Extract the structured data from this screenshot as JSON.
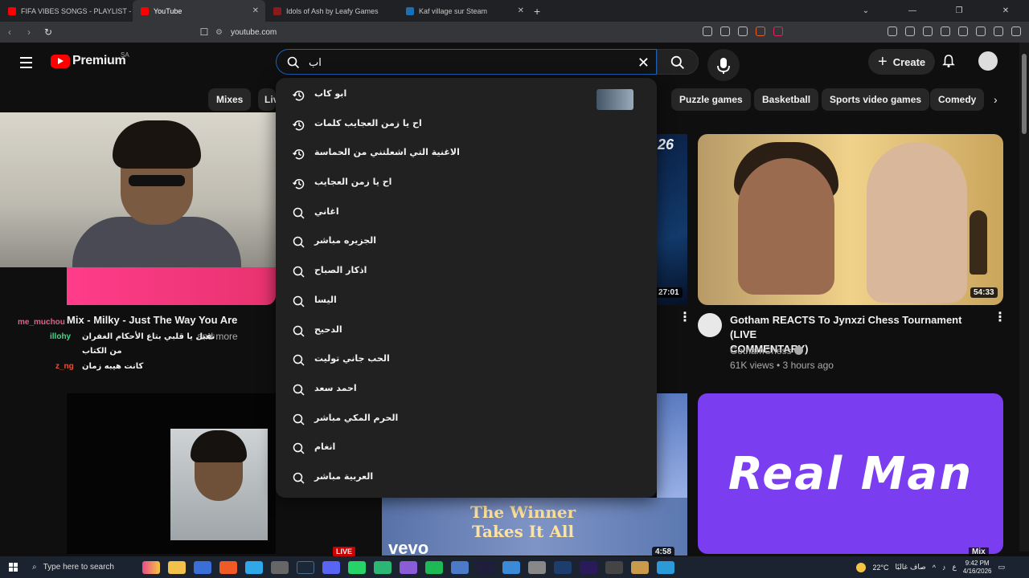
{
  "browser": {
    "tabs": [
      {
        "title": "FIFA VIBES SONGS - PLAYLIST - Y",
        "active": false,
        "favicon_color": "#ff0000"
      },
      {
        "title": "YouTube",
        "active": true,
        "favicon_color": "#ff0000"
      },
      {
        "title": "Idols of Ash by Leafy Games",
        "active": false,
        "favicon_color": "#8b1a1a"
      },
      {
        "title": "Kaf village sur Steam",
        "active": false,
        "favicon_color": "#1b6fb5"
      }
    ],
    "new_tab_label": "+",
    "url": "youtube.com"
  },
  "youtube": {
    "logo_text": "Premium",
    "region": "SA",
    "search_value": "اب",
    "create_label": "Create",
    "chips": [
      "Mixes",
      "Live",
      "Puzzle games",
      "Basketball",
      "Sports video games",
      "Comedy"
    ],
    "suggestions": [
      {
        "text": "ابو كاب",
        "kind": "history",
        "has_thumb": true
      },
      {
        "text": "اح يا زمن العجايب كلمات",
        "kind": "history"
      },
      {
        "text": "الاغنية التي اشعلتني من الحماسة",
        "kind": "history"
      },
      {
        "text": "اح يا زمن العجايب",
        "kind": "history"
      },
      {
        "text": "اغاني",
        "kind": "search"
      },
      {
        "text": "الجزيره مباشر",
        "kind": "search"
      },
      {
        "text": "اذكار الصباح",
        "kind": "search"
      },
      {
        "text": "اليسا",
        "kind": "search"
      },
      {
        "text": "الدحيح",
        "kind": "search"
      },
      {
        "text": "الحب جاني توليت",
        "kind": "search"
      },
      {
        "text": "احمد سعد",
        "kind": "search"
      },
      {
        "text": "الحرم المكي مباشر",
        "kind": "search"
      },
      {
        "text": "انغام",
        "kind": "search"
      },
      {
        "text": "العربية مباشر",
        "kind": "search"
      }
    ],
    "videos": {
      "mix_title": "Mix - Milky - Just The Way You Are",
      "mix_meta": "and more",
      "mid_duration": "27:01",
      "mid_badge": "26",
      "chess_title_1": "Gotham REACTS To Jynxzi Chess Tournament (LIVE",
      "chess_title_2": "COMMENTARY)",
      "chess_channel": "GothamChess",
      "chess_meta": "61K views • 3 hours ago",
      "chess_duration": "54:33",
      "winner_text_1": "The Winner",
      "winner_text_2": "Takes It All",
      "winner_brand": "vevo",
      "winner_duration": "4:58",
      "realman_text": "Real Man",
      "mix_badge": "Mix",
      "live_badge": "LIVE"
    },
    "chat": [
      {
        "user": "me_muchou",
        "msg": "",
        "color": "#e85d8a"
      },
      {
        "user": "illohy",
        "msg": "تقبل يا قلبي بتاع الأحكام الغفران",
        "color": "#3ddc84"
      },
      {
        "user": "",
        "msg": "من الكتاب",
        "color": "#ffffff"
      },
      {
        "user": "z_ng",
        "msg": "كانت هيبه زمان",
        "color": "#e0533a"
      }
    ]
  },
  "taskbar": {
    "search_placeholder": "Type here to search",
    "weather": "22°C",
    "weather_desc": "صاف غالبًا",
    "lang": "ع",
    "time": "9:42 PM",
    "date": "4/16/2026"
  }
}
